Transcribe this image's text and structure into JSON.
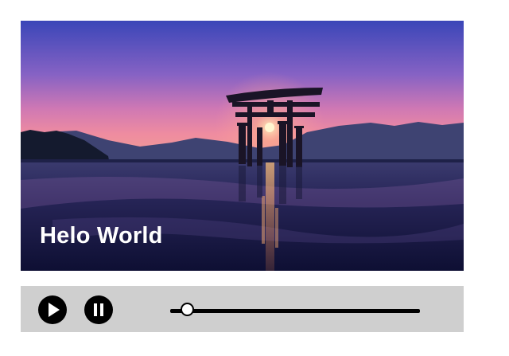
{
  "video": {
    "caption": "Helo World",
    "scene": "torii-gate-at-sunset"
  },
  "controls": {
    "play_icon": "play-icon",
    "pause_icon": "pause-icon",
    "progress": 0.07
  },
  "colors": {
    "control_bar": "#cfcfcf",
    "icon": "#000000",
    "caption": "#ffffff"
  }
}
